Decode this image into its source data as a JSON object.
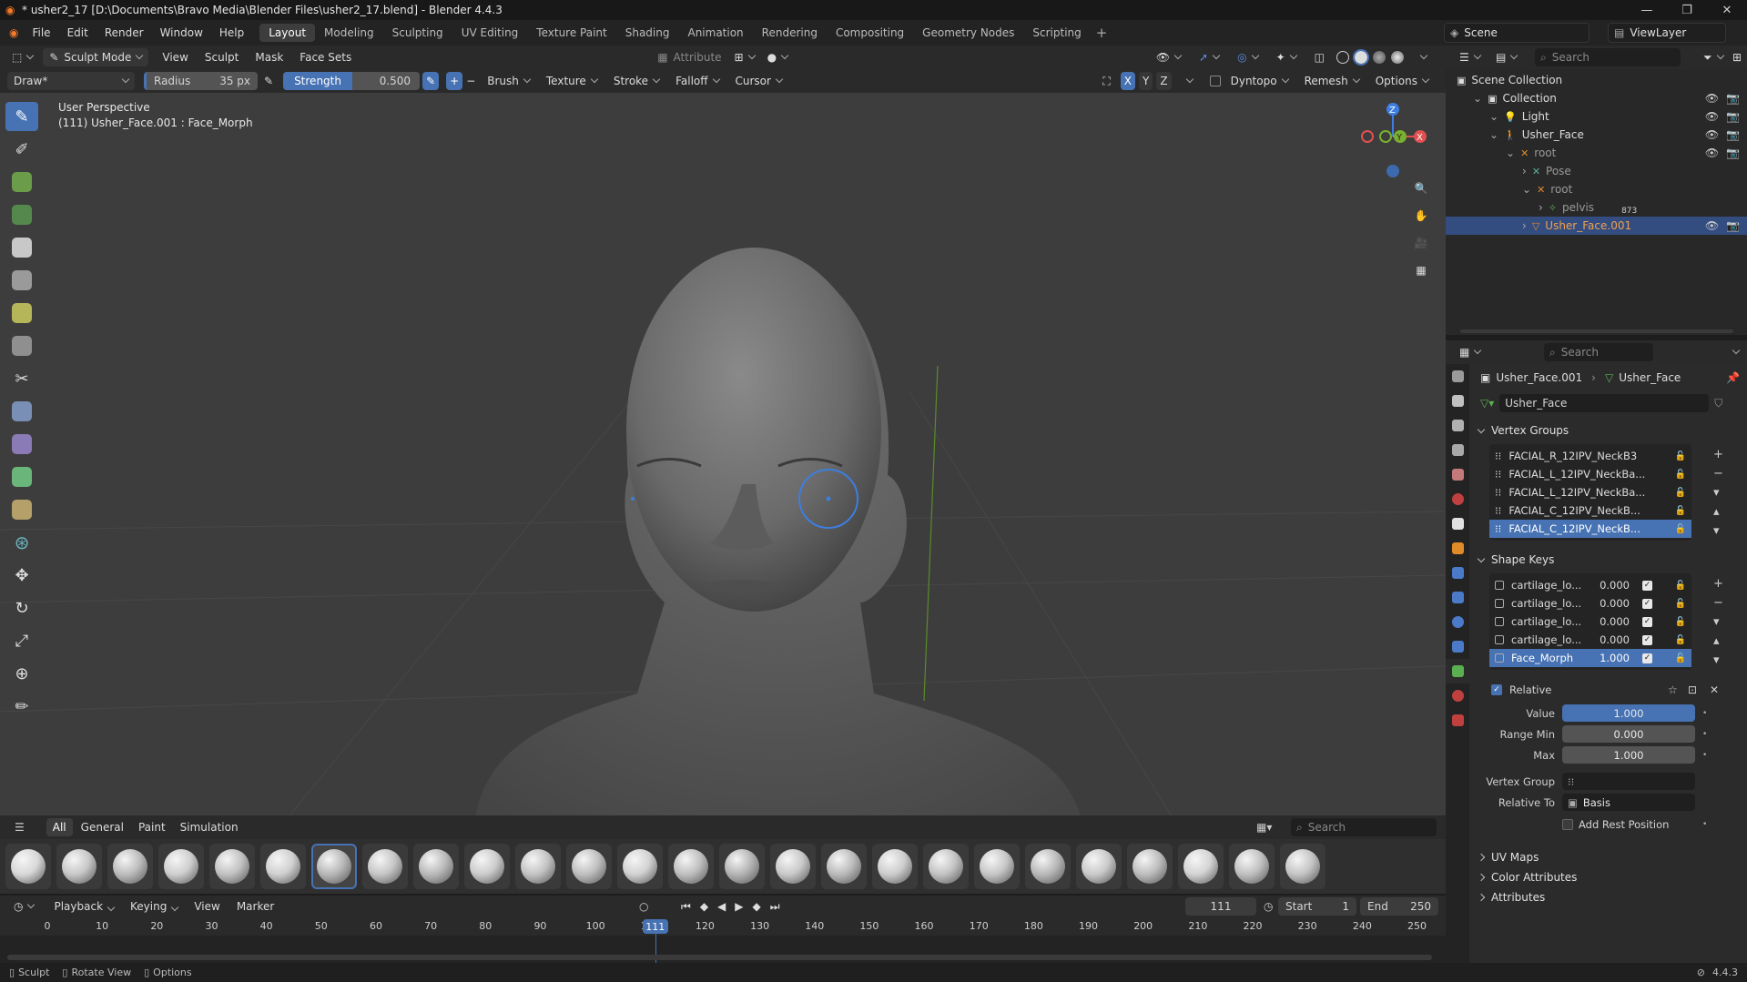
{
  "window": {
    "title": "* usher2_17 [D:\\Documents\\Bravo Media\\Blender Files\\usher2_17.blend] - Blender 4.4.3"
  },
  "menu": [
    "File",
    "Edit",
    "Render",
    "Window",
    "Help"
  ],
  "workspaces": [
    "Layout",
    "Modeling",
    "Sculpting",
    "UV Editing",
    "Texture Paint",
    "Shading",
    "Animation",
    "Rendering",
    "Compositing",
    "Geometry Nodes",
    "Scripting"
  ],
  "active_workspace": "Layout",
  "scene": {
    "name": "Scene",
    "view_layer": "ViewLayer"
  },
  "viewport_header": {
    "mode": "Sculpt Mode",
    "menus": [
      "View",
      "Sculpt",
      "Mask",
      "Face Sets"
    ],
    "attribute": "Attribute"
  },
  "tool_settings": {
    "brush_name": "Draw*",
    "radius_label": "Radius",
    "radius_value": "35 px",
    "strength_label": "Strength",
    "strength_value": "0.500",
    "menus": [
      "Brush",
      "Texture",
      "Stroke",
      "Falloff",
      "Cursor"
    ],
    "axes": [
      "X",
      "Y",
      "Z"
    ],
    "dyntopo": "Dyntopo",
    "remesh": "Remesh",
    "options": "Options"
  },
  "viewport": {
    "perspective": "User Perspective",
    "object_info": "(111) Usher_Face.001 : Face_Morph"
  },
  "brush_tray": {
    "tabs": [
      "All",
      "General",
      "Paint",
      "Simulation"
    ],
    "active_tab": "All",
    "search_placeholder": "Search",
    "active_index": 6
  },
  "timeline": {
    "menus": [
      "Playback",
      "Keying",
      "View",
      "Marker"
    ],
    "current_frame": "111",
    "start_label": "Start",
    "start": "1",
    "end_label": "End",
    "end": "250",
    "ticks": [
      "0",
      "10",
      "20",
      "30",
      "40",
      "50",
      "60",
      "70",
      "80",
      "90",
      "100",
      "110",
      "120",
      "130",
      "140",
      "150",
      "160",
      "170",
      "180",
      "190",
      "200",
      "210",
      "220",
      "230",
      "240",
      "250"
    ],
    "playhead_label": "111"
  },
  "status_bar": {
    "items": [
      "Sculpt",
      "Rotate View",
      "Options"
    ],
    "version": "4.4.3"
  },
  "outliner": {
    "search_placeholder": "Search",
    "rows": [
      {
        "label": "Scene Collection",
        "indent": 0
      },
      {
        "label": "Collection",
        "indent": 1
      },
      {
        "label": "Light",
        "indent": 2
      },
      {
        "label": "Usher_Face",
        "indent": 2
      },
      {
        "label": "root",
        "indent": 3
      },
      {
        "label": "Pose",
        "indent": 4
      },
      {
        "label": "root",
        "indent": 4
      },
      {
        "label": "pelvis",
        "indent": 5,
        "badge": "873"
      },
      {
        "label": "Usher_Face.001",
        "indent": 4,
        "selected": true
      }
    ]
  },
  "properties": {
    "search_placeholder": "Search",
    "breadcrumb_object": "Usher_Face.001",
    "breadcrumb_data": "Usher_Face",
    "mesh_name": "Usher_Face",
    "vertex_groups_title": "Vertex Groups",
    "vertex_groups": [
      "FACIAL_R_12IPV_NeckB3",
      "FACIAL_L_12IPV_NeckBa...",
      "FACIAL_L_12IPV_NeckBa...",
      "FACIAL_C_12IPV_NeckB...",
      "FACIAL_C_12IPV_NeckB..."
    ],
    "shape_keys_title": "Shape Keys",
    "shape_keys": [
      {
        "name": "cartilage_lo...",
        "value": "0.000"
      },
      {
        "name": "cartilage_lo...",
        "value": "0.000"
      },
      {
        "name": "cartilage_lo...",
        "value": "0.000"
      },
      {
        "name": "cartilage_lo...",
        "value": "0.000"
      },
      {
        "name": "Face_Morph",
        "value": "1.000"
      }
    ],
    "relative_label": "Relative",
    "value_label": "Value",
    "value": "1.000",
    "range_min_label": "Range Min",
    "range_min": "0.000",
    "max_label": "Max",
    "max": "1.000",
    "vertex_group_label": "Vertex Group",
    "relative_to_label": "Relative To",
    "relative_to": "Basis",
    "add_rest_label": "Add Rest Position",
    "collapsed_sections": [
      "UV Maps",
      "Color Attributes",
      "Attributes"
    ]
  }
}
